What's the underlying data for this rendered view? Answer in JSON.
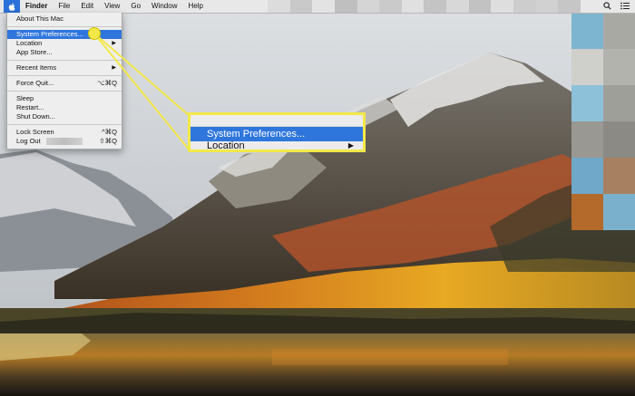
{
  "menubar": {
    "apple_icon": "apple-logo-icon",
    "items": [
      "Finder",
      "File",
      "Edit",
      "View",
      "Go",
      "Window",
      "Help"
    ],
    "right_icons": [
      "search-icon",
      "notification-list-icon"
    ]
  },
  "apple_menu": {
    "about": "About This Mac",
    "system_preferences": "System Preferences...",
    "location": "Location",
    "app_store": "App Store...",
    "recent_items": "Recent Items",
    "force_quit": "Force Quit...",
    "force_quit_shortcut": "⌥⌘Q",
    "sleep": "Sleep",
    "restart": "Restart...",
    "shut_down": "Shut Down...",
    "lock_screen": "Lock Screen",
    "lock_screen_shortcut": "^⌘Q",
    "log_out": "Log Out",
    "log_out_shortcut": "⇧⌘Q"
  },
  "zoom_callout": {
    "selected": "System Preferences...",
    "next": "Location"
  },
  "colors": {
    "highlight": "#2f76dc",
    "callout": "#f3e84a"
  }
}
